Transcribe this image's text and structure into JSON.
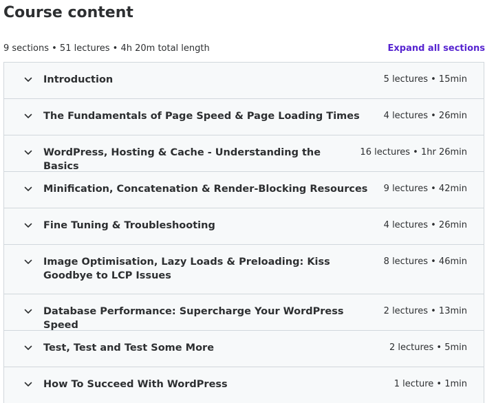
{
  "header": {
    "title": "Course content",
    "summary": "9 sections • 51 lectures • 4h 20m total length",
    "expand_all_label": "Expand all sections"
  },
  "icons": {
    "section_toggle": "chevron-down-icon"
  },
  "colors": {
    "accent": "#5624d0",
    "section_bg": "#f7f9fa",
    "border": "#d1d7dc",
    "text": "#2d2f31"
  },
  "sections": [
    {
      "title": "Introduction",
      "meta": "5 lectures • 15min"
    },
    {
      "title": "The Fundamentals of Page Speed & Page Loading Times",
      "meta": "4 lectures • 26min"
    },
    {
      "title": "WordPress, Hosting & Cache - Understanding the Basics",
      "meta": "16 lectures • 1hr 26min"
    },
    {
      "title": "Minification, Concatenation & Render-Blocking Resources",
      "meta": "9 lectures • 42min"
    },
    {
      "title": "Fine Tuning & Troubleshooting",
      "meta": "4 lectures • 26min"
    },
    {
      "title": "Image Optimisation, Lazy Loads & Preloading: Kiss Goodbye to LCP Issues",
      "meta": "8 lectures • 46min"
    },
    {
      "title": "Database Performance: Supercharge Your WordPress Speed",
      "meta": "2 lectures • 13min"
    },
    {
      "title": "Test, Test and Test Some More",
      "meta": "2 lectures • 5min"
    },
    {
      "title": "How To Succeed With WordPress",
      "meta": "1 lecture • 1min"
    }
  ]
}
